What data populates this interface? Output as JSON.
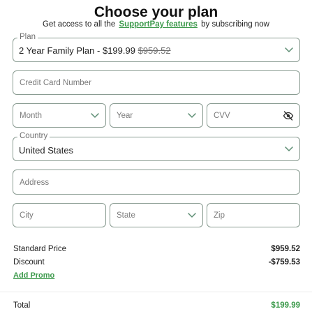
{
  "header": {
    "title": "Choose your plan",
    "subtitle_pre": "Get access to all the",
    "subtitle_link": "SupportPay features",
    "subtitle_post": "by subscribing now"
  },
  "plan": {
    "legend": "Plan",
    "selected_label": "2 Year Family Plan -",
    "price": "$199.99",
    "original_price": "$959.52"
  },
  "card": {
    "placeholder": "Credit Card Number"
  },
  "expiry": {
    "month_placeholder": "Month",
    "year_placeholder": "Year"
  },
  "cvv": {
    "placeholder": "CVV"
  },
  "country": {
    "legend": "Country",
    "value": "United States"
  },
  "address": {
    "placeholder": "Address"
  },
  "city": {
    "placeholder": "City"
  },
  "state": {
    "placeholder": "State"
  },
  "zip": {
    "placeholder": "Zip"
  },
  "summary": {
    "standard_label": "Standard Price",
    "standard_value": "$959.52",
    "discount_label": "Discount",
    "discount_value": "-$759.53",
    "promo_label": "Add Promo",
    "total_label": "Total",
    "total_value": "$199.99"
  },
  "colors": {
    "accent": "#3d9a4c",
    "border": "#8a9c92",
    "chevron": "#5e8e74"
  },
  "icons": {
    "dropdown": "chevron-down-icon",
    "cvv_toggle": "eye-slash-icon"
  }
}
